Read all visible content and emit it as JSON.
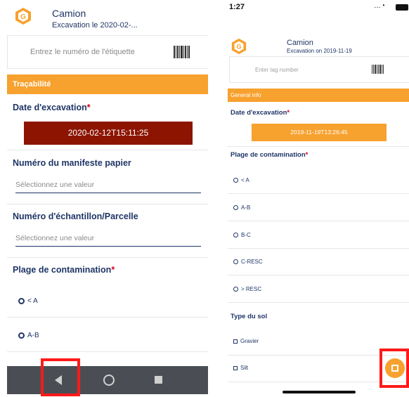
{
  "android": {
    "app_title": "Camion",
    "app_subtitle": "Excavation le 2020-02-...",
    "tag_placeholder": "Entrez le numéro de l'étiquette",
    "section_title": "Traçabilité",
    "date_label": "Date d'excavation",
    "date_value": "2020-02-12T15:11:25",
    "manifest_label": "Numéro du manifeste papier",
    "manifest_placeholder": "Sélectionnez une valeur",
    "sample_label": "Numéro d'échantillon/Parcelle",
    "sample_placeholder": "Sélectionnez une valeur",
    "contamination_label": "Plage de contamination",
    "options": [
      "< A",
      "A-B"
    ],
    "required_mark": "*"
  },
  "ios": {
    "status_time": "1:27",
    "app_title": "Camion",
    "app_subtitle": "Excavation on 2019-11-19",
    "tag_placeholder": "Enter tag number",
    "section_title": "General info",
    "date_label": "Date d'excavation",
    "date_value": "2019-11-19T13:26:45",
    "contamination_label": "Plage de contamination",
    "options": [
      "< A",
      "A-B",
      "B-C",
      "C-RESC",
      "> RESC"
    ],
    "soil_label": "Type du sol",
    "soil_options": [
      "Gravier",
      "Silt"
    ],
    "required_mark": "*"
  },
  "colors": {
    "accent_orange": "#f7a12e",
    "navy": "#1f3566",
    "date_dark_red": "#8c1400",
    "required_red": "#d0021b",
    "highlight_red": "#ff1a1a"
  },
  "icons": [
    "app-logo-icon",
    "barcode-icon",
    "back-icon",
    "home-icon",
    "recents-icon",
    "save-icon",
    "wifi-icon",
    "battery-icon"
  ]
}
